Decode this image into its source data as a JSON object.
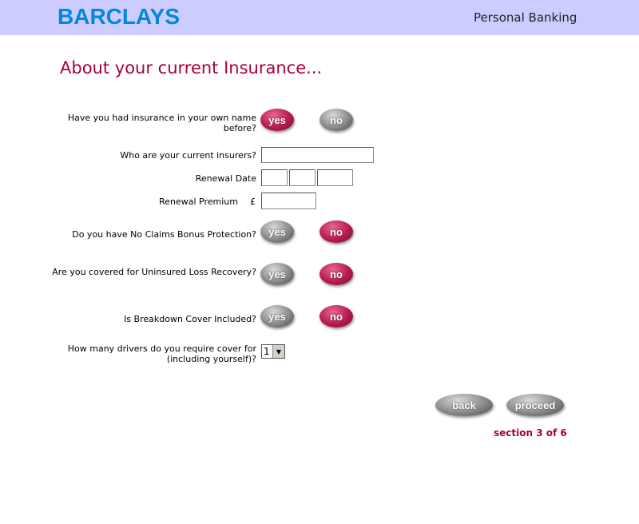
{
  "header": {
    "brand": "BARCLAYS",
    "area": "Personal Banking"
  },
  "page_title": "About your current Insurance...",
  "questions": {
    "had_insurance": {
      "label": "Have you had insurance in your own name before?",
      "yes": "yes",
      "no": "no",
      "selected": "yes"
    },
    "current_insurers": {
      "label": "Who are your current insurers?",
      "value": ""
    },
    "renewal_date": {
      "label": "Renewal Date"
    },
    "renewal_premium": {
      "label": "Renewal Premium",
      "currency": "£",
      "value": ""
    },
    "ncb_protection": {
      "label": "Do you have No Claims Bonus Protection?",
      "yes": "yes",
      "no": "no",
      "selected": "no"
    },
    "uninsured_loss": {
      "label": "Are you covered for Uninsured Loss Recovery?",
      "yes": "yes",
      "no": "no",
      "selected": "no"
    },
    "breakdown": {
      "label": "Is Breakdown Cover Included?",
      "yes": "yes",
      "no": "no",
      "selected": "no"
    },
    "drivers": {
      "label": "How many drivers do you require cover for (including yourself)?",
      "value": "1"
    }
  },
  "nav": {
    "back": "back",
    "proceed": "proceed"
  },
  "section": "section 3 of 6",
  "colors": {
    "header_bg": "#ccccff",
    "brand": "#0088dd",
    "accent": "#aa0033"
  }
}
